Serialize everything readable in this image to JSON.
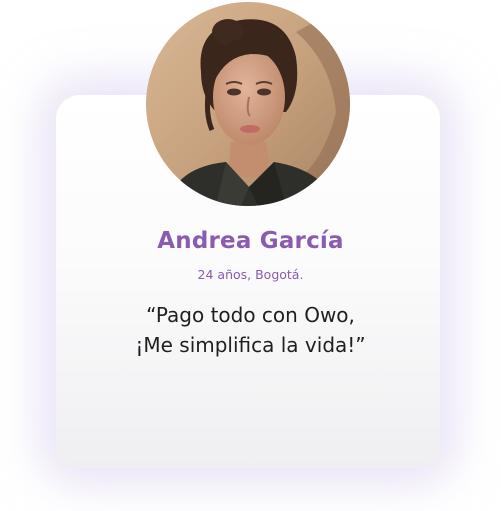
{
  "testimonial": {
    "name": "Andrea García",
    "details": "24 años, Bogotá.",
    "quote_line_1": "“Pago todo con Owo,",
    "quote_line_2": "¡Me simplifica la vida!”"
  },
  "colors": {
    "accent": "#8a5bb0",
    "text": "#1f1f1f",
    "glow": "#d6caec"
  }
}
